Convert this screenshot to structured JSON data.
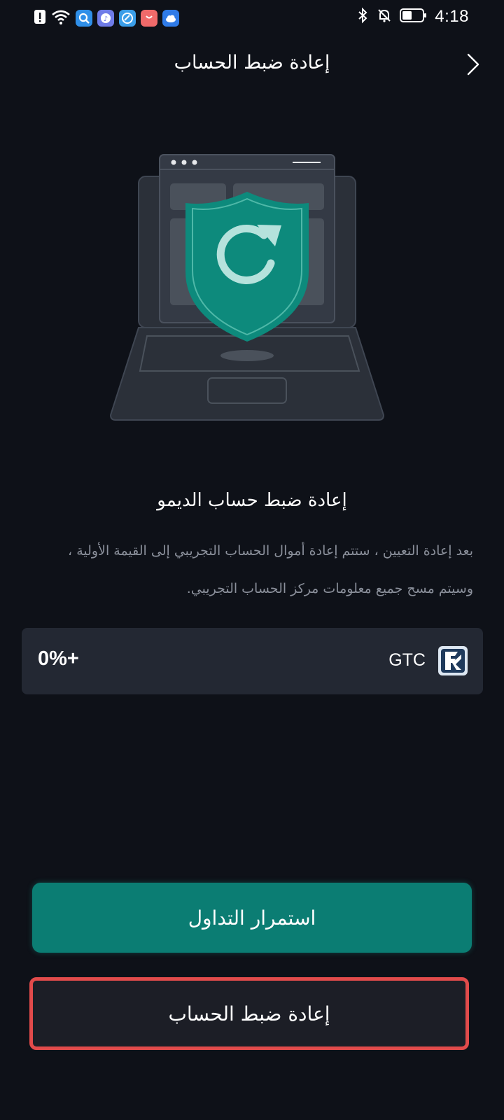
{
  "status_bar": {
    "time": "4:18",
    "left_icons": [
      "alert-icon",
      "wifi-icon",
      "search-app-icon",
      "music-app-icon",
      "browser-app-icon",
      "shopping-app-icon",
      "cloud-app-icon"
    ],
    "right_icons": [
      "bluetooth-icon",
      "mute-bell-icon",
      "battery-icon"
    ]
  },
  "header": {
    "title": "إعادة ضبط الحساب"
  },
  "content": {
    "title": "إعادة ضبط حساب الديمو",
    "description": "بعد إعادة التعيين ، ستتم إعادة أموال الحساب التجريبي إلى القيمة الأولية ، وسيتم مسح جميع معلومات مركز الحساب التجريبي."
  },
  "coin": {
    "name": "GTC",
    "change": "0%+"
  },
  "buttons": {
    "continue_label": "استمرار التداول",
    "reset_label": "إعادة ضبط الحساب"
  },
  "colors": {
    "background": "#0e1118",
    "accent": "#0b7d73",
    "card": "#232833",
    "highlight_border": "#e24b4b"
  }
}
